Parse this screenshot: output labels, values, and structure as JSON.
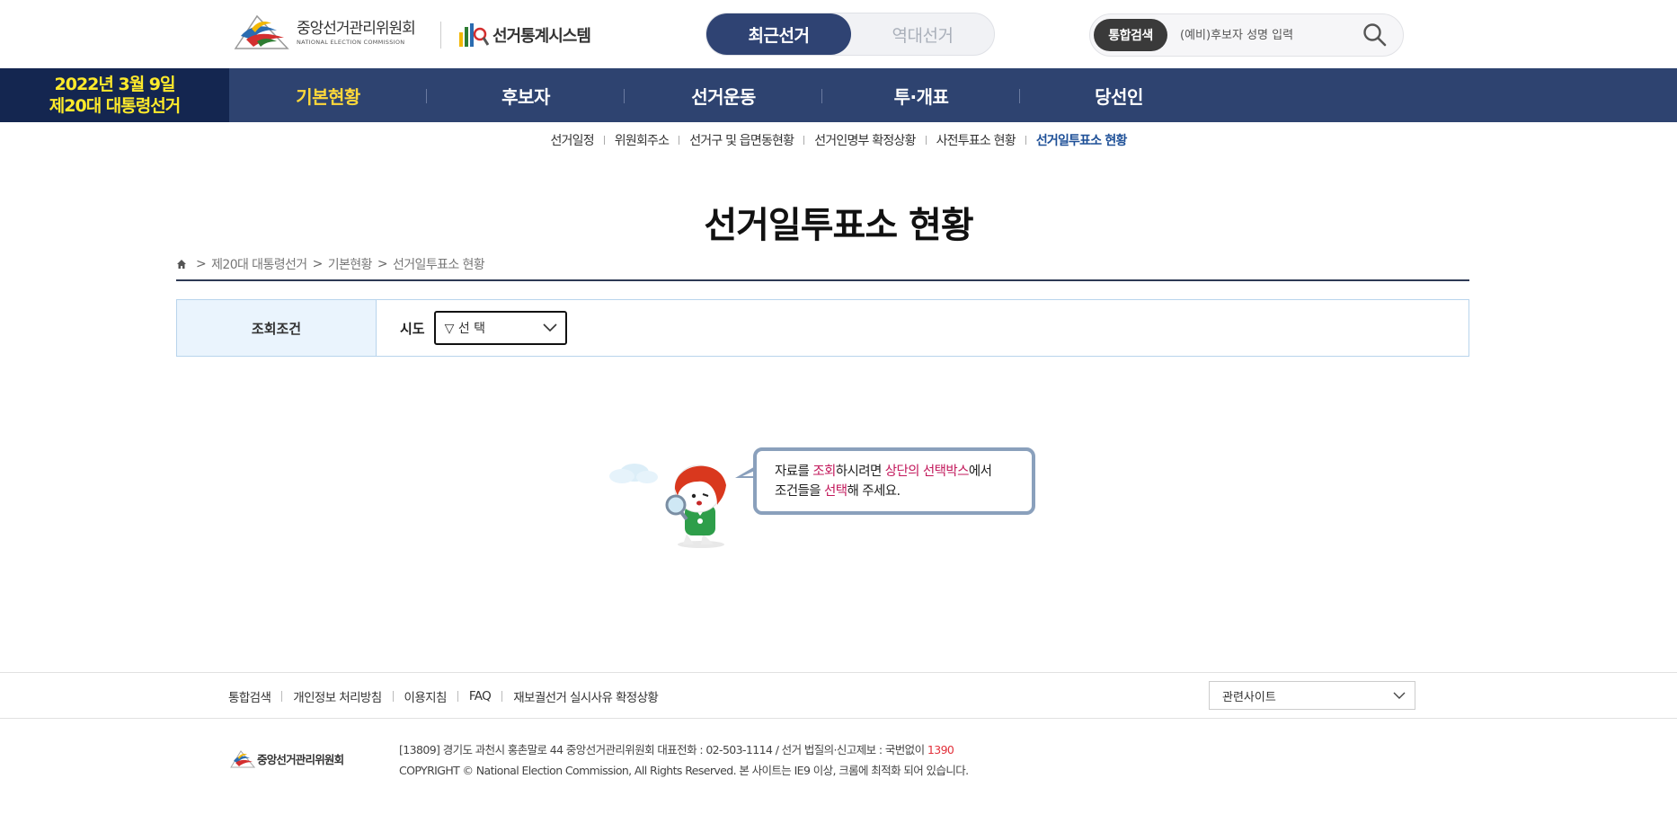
{
  "header": {
    "nec_logo": {
      "ko": "중앙선거관리위원회",
      "en": "NATIONAL ELECTION COMMISSION"
    },
    "stat_logo": "선거통계시스템",
    "toggle": {
      "current": "최근선거",
      "history": "역대선거"
    },
    "search": {
      "badge": "통합검색",
      "placeholder": "(예비)후보자 성명 입력"
    }
  },
  "nav": {
    "date_line1": "2022년 3월 9일",
    "date_line2": "제20대 대통령선거",
    "items": [
      "기본현황",
      "후보자",
      "선거운동",
      "투·개표",
      "당선인"
    ]
  },
  "subnav": {
    "items": [
      "선거일정",
      "위원회주소",
      "선거구 및 읍면동현황",
      "선거인명부 확정상황",
      "사전투표소 현황",
      "선거일투표소 현황"
    ]
  },
  "page": {
    "title": "선거일투표소 현황",
    "breadcrumb": [
      "제20대 대통령선거",
      "기본현황",
      "선거일투표소 현황"
    ]
  },
  "condition": {
    "label": "조회조건",
    "sido_label": "시도",
    "select_value": "▽ 선 택"
  },
  "message": {
    "p1": "자료를 ",
    "h1": "조회",
    "p2": "하시려면 ",
    "h2": "상단의 선택박스",
    "p3": "에서",
    "p4": "조건들을 ",
    "h3": "선택",
    "p5": "해 주세요."
  },
  "footer": {
    "links": [
      "통합검색",
      "개인정보 처리방침",
      "이용지침",
      "FAQ",
      "재보궐선거 실시사유 확정상황"
    ],
    "related": "관련사이트",
    "logo_text": "중앙선거관리위원회",
    "address": "[13809] 경기도 과천시 홍촌말로 44 중앙선거관리위원회 대표전화 : 02-503-1114 / 선거 법질의·신고제보 : 국번없이 ",
    "report_number": "1390",
    "copyright": "COPYRIGHT © National Election Commission, All Rights Reserved. 본 사이트는 IE9 이상, 크롬에 최적화 되어 있습니다."
  },
  "colors": {
    "nav_bg": "#2e4370",
    "nav_date_bg": "#142650",
    "date_text": "#ffea2b",
    "active_nav": "#ffd83a",
    "highlight": "#c2185b"
  }
}
